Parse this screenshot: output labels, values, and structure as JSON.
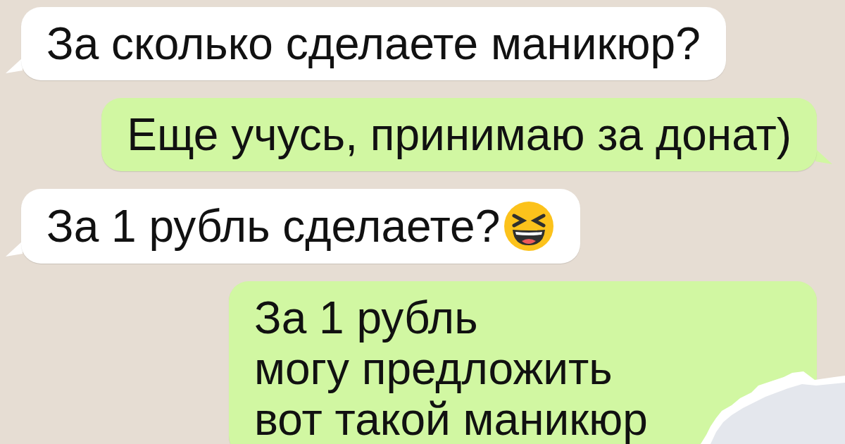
{
  "messages": [
    {
      "outgoing": false,
      "text": "За сколько сделаете маникюр?",
      "emoji": false
    },
    {
      "outgoing": true,
      "text": "Еще учусь, принимаю за донат)",
      "emoji": false
    },
    {
      "outgoing": false,
      "text": "За 1 рубль сделаете?",
      "emoji": true
    },
    {
      "outgoing": true,
      "text": "За 1 рубль\nмогу предложить\nвот такой маникюр",
      "emoji": false
    }
  ]
}
